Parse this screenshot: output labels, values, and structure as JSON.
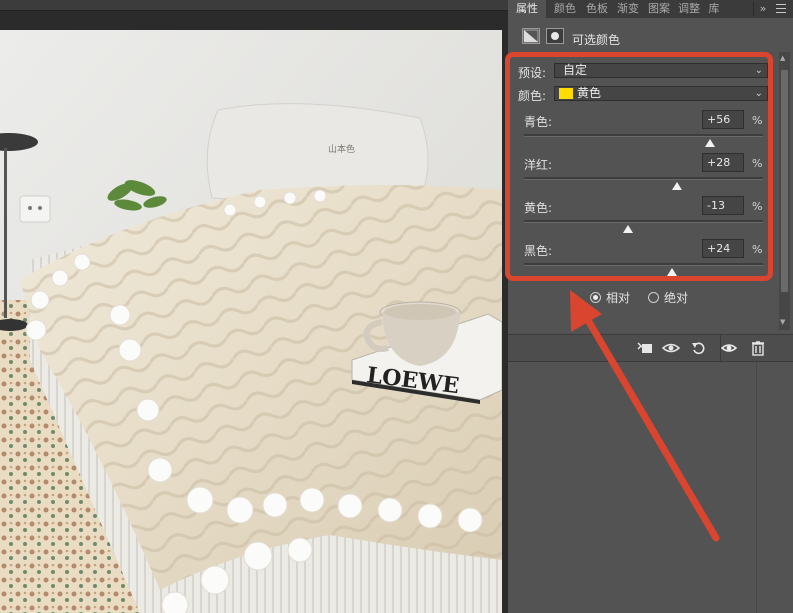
{
  "tabs": [
    {
      "label": "属性",
      "active": true
    },
    {
      "label": "颜色",
      "active": false
    },
    {
      "label": "色板",
      "active": false
    },
    {
      "label": "渐变",
      "active": false
    },
    {
      "label": "图案",
      "active": false
    },
    {
      "label": "调整",
      "active": false
    },
    {
      "label": "库",
      "active": false
    }
  ],
  "panel": {
    "title": "可选颜色",
    "preset_label": "预设:",
    "preset_value": "自定",
    "colors_label": "颜色:",
    "colors_value": "黄色",
    "colors_swatch": "#ffdd00",
    "method_relative": "相对",
    "method_absolute": "绝对",
    "method_selected": "相对"
  },
  "sliders": [
    {
      "label": "青色:",
      "value": "+56",
      "unit": "%",
      "level": 56
    },
    {
      "label": "洋红:",
      "value": "+28",
      "unit": "%",
      "level": 28
    },
    {
      "label": "黄色:",
      "value": "-13",
      "unit": "%",
      "level": -13
    },
    {
      "label": "黑色:",
      "value": "+24",
      "unit": "%",
      "level": 24
    }
  ],
  "photo": {
    "box_text": "LOEWE",
    "pillow_text": "山本色"
  },
  "annotation_color": "#d9452f"
}
